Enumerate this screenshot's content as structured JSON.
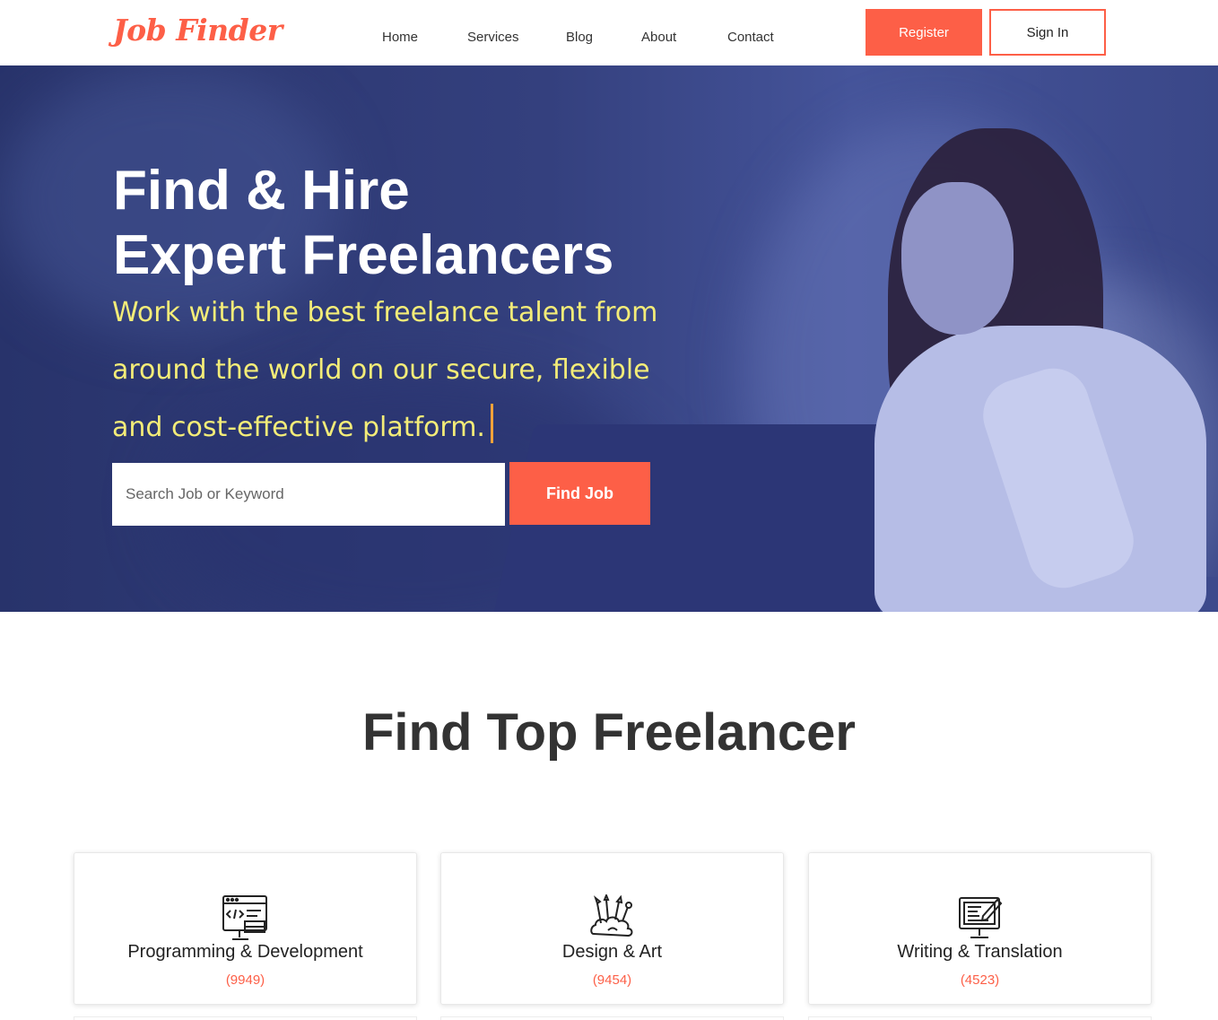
{
  "header": {
    "logo": "Job Finder",
    "nav": [
      "Home",
      "Services",
      "Blog",
      "About",
      "Contact"
    ],
    "register_label": "Register",
    "signin_label": "Sign In"
  },
  "hero": {
    "title_line1": "Find & Hire",
    "title_line2": "Expert Freelancers",
    "tagline": "Work with the best freelance talent from around the world on our secure, flexible and cost-effective platform.",
    "search_placeholder": "Search Job or Keyword",
    "find_button": "Find Job"
  },
  "section": {
    "title": "Find Top Freelancer",
    "categories": [
      {
        "title": "Programming & Development",
        "count": "(9949)",
        "icon": "code-monitor-icon"
      },
      {
        "title": "Design & Art",
        "count": "(9454)",
        "icon": "art-supplies-icon"
      },
      {
        "title": "Writing & Translation",
        "count": "(4523)",
        "icon": "writing-monitor-icon"
      }
    ]
  },
  "colors": {
    "accent": "#fd5f47",
    "hero_overlay": "#2f3a78",
    "tagline": "#f3ec78"
  }
}
